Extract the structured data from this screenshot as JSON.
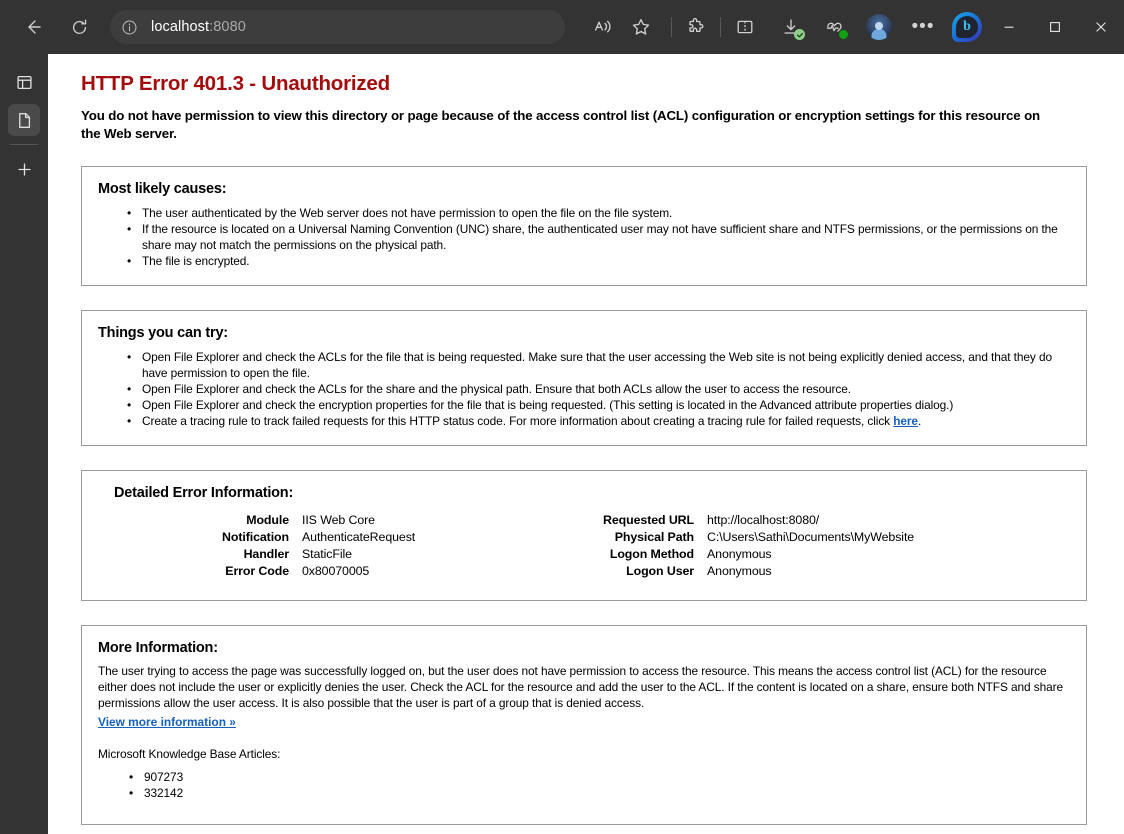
{
  "browser": {
    "back_label": "Back",
    "refresh_label": "Refresh",
    "address": {
      "host": "localhost",
      "port": ":8080",
      "full": "localhost:8080",
      "site_info_label": "View site information"
    },
    "toolbar": [
      {
        "name": "read-aloud-icon",
        "label": "Read aloud"
      },
      {
        "name": "favorites-icon",
        "label": "Add this page to favorites"
      },
      {
        "name": "extensions-icon",
        "label": "Extensions"
      },
      {
        "name": "split-screen-icon",
        "label": "Split screen"
      },
      {
        "name": "downloads-icon",
        "label": "Downloads"
      },
      {
        "name": "browser-essentials-icon",
        "label": "Browser essentials"
      },
      {
        "name": "profile-avatar",
        "label": "Profile"
      },
      {
        "name": "settings-more-icon",
        "label": "Settings and more"
      },
      {
        "name": "copilot-icon",
        "label": "Copilot"
      }
    ],
    "window_controls": {
      "minimize": "Minimize",
      "maximize": "Maximize",
      "close": "Close"
    },
    "sidebar": [
      {
        "name": "sidebar-item-tab-actions",
        "label": "Tab actions menu"
      },
      {
        "name": "sidebar-item-page",
        "label": "localhost:8080",
        "active": true
      },
      {
        "name": "sidebar-item-new-tab",
        "label": "New tab"
      }
    ]
  },
  "page": {
    "title": "HTTP Error 401.3 - Unauthorized",
    "subtitle": "You do not have permission to view this directory or page because of the access control list (ACL) configuration or encryption settings for this resource on the Web server.",
    "causes": {
      "heading": "Most likely causes:",
      "items": [
        "The user authenticated by the Web server does not have permission to open the file on the file system.",
        "If the resource is located on a Universal Naming Convention (UNC) share, the authenticated user may not have sufficient share and NTFS permissions, or the permissions on the share may not match the permissions on the physical path.",
        "The file is encrypted."
      ]
    },
    "try": {
      "heading": "Things you can try:",
      "items": [
        "Open File Explorer and check the ACLs for the file that is being requested. Make sure that the user accessing the Web site is not being explicitly denied access, and that they do have permission to open the file.",
        "Open File Explorer and check the ACLs for the share and the physical path. Ensure that both ACLs allow the user to access the resource.",
        "Open File Explorer and check the encryption properties for the file that is being requested. (This setting is located in the Advanced attribute properties dialog.)"
      ],
      "tracing_prefix": "Create a tracing rule to track failed requests for this HTTP status code. For more information about creating a tracing rule for failed requests, click ",
      "tracing_link": "here",
      "tracing_suffix": "."
    },
    "details": {
      "heading": "Detailed Error Information:",
      "left": [
        {
          "label": "Module",
          "value": "IIS Web Core"
        },
        {
          "label": "Notification",
          "value": "AuthenticateRequest"
        },
        {
          "label": "Handler",
          "value": "StaticFile"
        },
        {
          "label": "Error Code",
          "value": "0x80070005"
        }
      ],
      "right": [
        {
          "label": "Requested URL",
          "value": "http://localhost:8080/"
        },
        {
          "label": "Physical Path",
          "value": "C:\\Users\\Sathi\\Documents\\MyWebsite"
        },
        {
          "label": "Logon Method",
          "value": "Anonymous"
        },
        {
          "label": "Logon User",
          "value": "Anonymous"
        }
      ]
    },
    "more": {
      "heading": "More Information:",
      "paragraph": "The user trying to access the page was successfully logged on, but the user does not have permission to access the resource. This means the access control list (ACL) for the resource either does not include the user or explicitly denies the user. Check the ACL for the resource and add the user to the ACL. If the content is located on a share, ensure both NTFS and share permissions allow the user access. It is also possible that the user is part of a group that is denied access.",
      "link": "View more information »",
      "kb_heading": "Microsoft Knowledge Base Articles:",
      "kb_items": [
        "907273",
        "332142"
      ]
    }
  },
  "colors": {
    "error_title": "#a30c0c",
    "link": "#1560bd",
    "chrome_bg": "#333333",
    "page_bg": "#ffffff",
    "box_border": "#9a9a9a"
  }
}
